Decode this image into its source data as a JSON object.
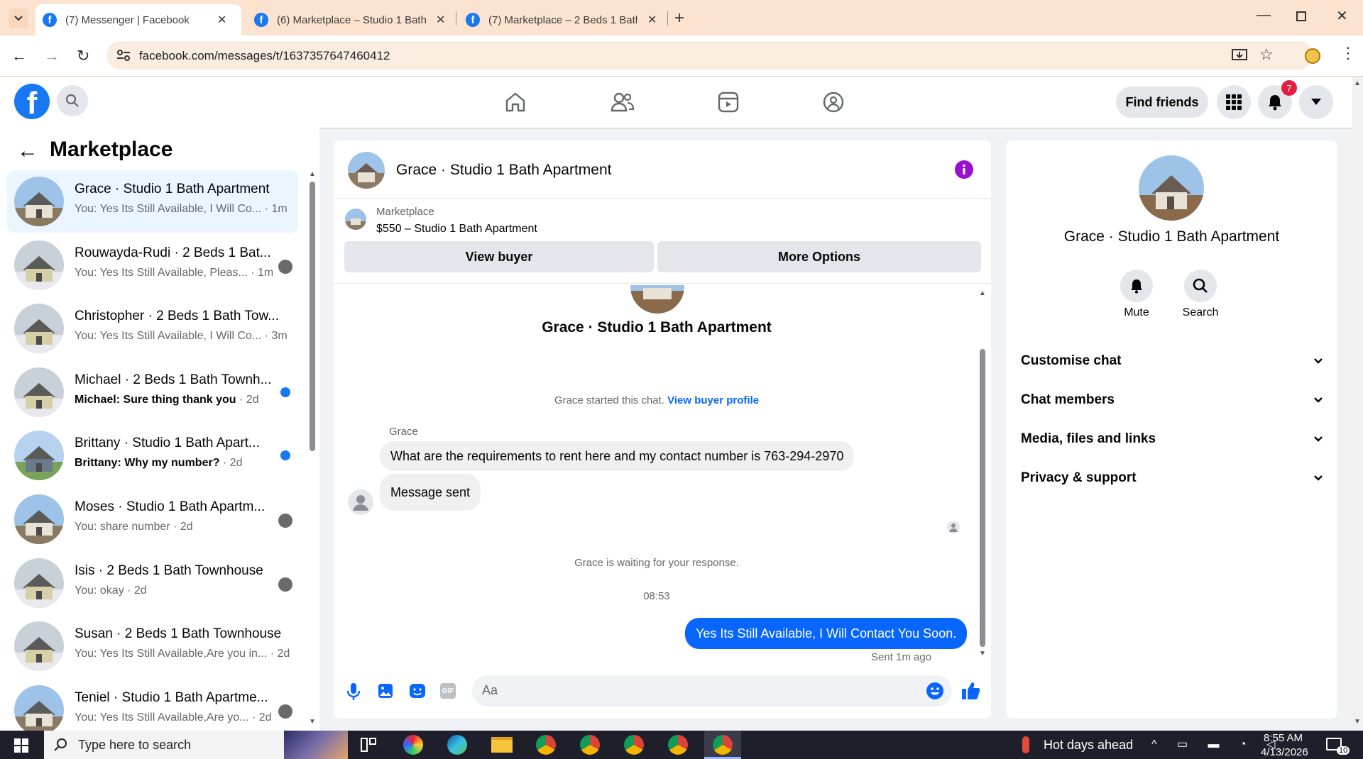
{
  "browser": {
    "tabs": [
      {
        "title": "(7) Messenger | Facebook",
        "active": true
      },
      {
        "title": "(6) Marketplace – Studio 1 Bath",
        "active": false
      },
      {
        "title": "(7) Marketplace – 2 Beds 1 Bath",
        "active": false
      }
    ],
    "url": "facebook.com/messages/t/1637357647460412"
  },
  "header": {
    "find_friends": "Find friends",
    "notif_count": "7"
  },
  "sidebar": {
    "title": "Marketplace",
    "conversations": [
      {
        "name": "Grace · Studio 1 Bath Apartment",
        "preview": "You: Yes Its Still Available, I Will Co...",
        "time": "1m",
        "unread": false,
        "active": true
      },
      {
        "name": "Rouwayda-Rudi · 2 Beds 1 Bat...",
        "preview": "You: Yes Its Still Available, Pleas...",
        "time": "1m",
        "unread": false,
        "active": false
      },
      {
        "name": "Christopher · 2 Beds 1 Bath Tow...",
        "preview": "You: Yes Its Still Available, I Will Co...",
        "time": "3m",
        "unread": false,
        "active": false
      },
      {
        "name": "Michael · 2 Beds 1 Bath Townh...",
        "preview": "Michael: Sure thing thank you",
        "time": "2d",
        "unread": true,
        "active": false
      },
      {
        "name": "Brittany · Studio 1 Bath Apart...",
        "preview": "Brittany: Why my number?",
        "time": "2d",
        "unread": true,
        "active": false
      },
      {
        "name": "Moses · Studio 1 Bath Apartm...",
        "preview": "You: share number",
        "time": "2d",
        "unread": false,
        "active": false
      },
      {
        "name": "Isis · 2 Beds 1 Bath Townhouse",
        "preview": "You: okay",
        "time": "2d",
        "unread": false,
        "active": false
      },
      {
        "name": "Susan · 2 Beds 1 Bath Townhouse",
        "preview": "You: Yes Its Still Available,Are you in...",
        "time": "2d",
        "unread": false,
        "active": false
      },
      {
        "name": "Teniel · Studio 1 Bath Apartme...",
        "preview": "You: Yes Its Still Available,Are yo...",
        "time": "2d",
        "unread": false,
        "active": false
      }
    ]
  },
  "chat": {
    "title": "Grace · Studio 1 Bath Apartment",
    "listing_source": "Marketplace",
    "listing_title": "$550 – Studio 1 Bath Apartment",
    "view_buyer": "View buyer",
    "more_options": "More Options",
    "intro_name": "Grace · Studio 1 Bath Apartment",
    "started_text": "Grace started this chat.",
    "view_profile": "View buyer profile",
    "sender_name": "Grace",
    "msg1": "What are the requirements to rent here and my contact number is 763-294-2970",
    "msg2": "Message sent",
    "waiting": "Grace is waiting for your response.",
    "time": "08:53",
    "my_msg": "Yes Its Still Available, I Will Contact You Soon.",
    "sent_status": "Sent 1m ago",
    "composer_placeholder": "Aa"
  },
  "info_panel": {
    "name": "Grace · Studio 1 Bath Apartment",
    "mute": "Mute",
    "search": "Search",
    "sections": [
      "Customise chat",
      "Chat members",
      "Media, files and links",
      "Privacy & support"
    ]
  },
  "taskbar": {
    "search_placeholder": "Type here to search",
    "weather": "Hot days ahead",
    "clock_time": "8:55 AM",
    "clock_date": "4/13/2026",
    "notif": "10"
  },
  "colors": {
    "fb_blue": "#1877f2",
    "bubble_blue": "#0866ff",
    "info_purple": "#9a0fd4"
  }
}
